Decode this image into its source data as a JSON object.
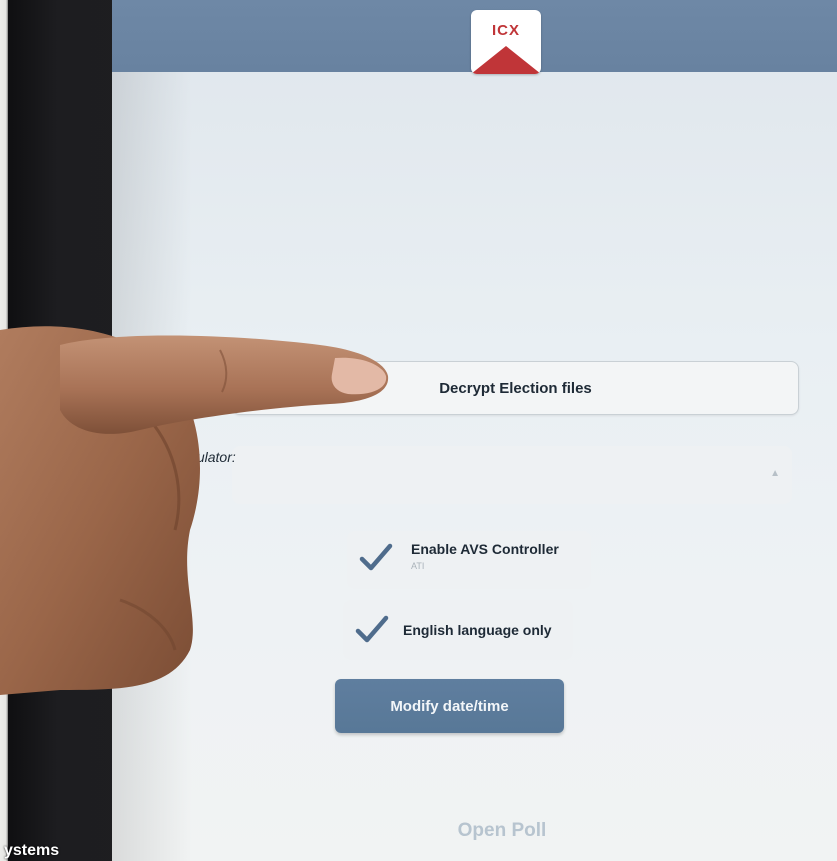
{
  "header": {
    "logo_text": "ICX",
    "colors": {
      "bar": "#6882a0",
      "logo_red": "#c03538"
    }
  },
  "main": {
    "decrypt_label": "Decrypt Election files",
    "tabulator_label": "Tabulator:",
    "tabulator_value": "",
    "avs": {
      "label": "Enable AVS Controller",
      "sublabel": "ATI",
      "checked": true,
      "icon": "checkmark-icon"
    },
    "english": {
      "label": "English language only",
      "checked": true,
      "icon": "checkmark-icon"
    },
    "modify_label": "Modify date/time",
    "open_poll_label": "Open Poll",
    "colors": {
      "primary_button": "#587897",
      "check": "#4f6c8c",
      "disabled_text": "#b7c4cf"
    }
  },
  "overlay": {
    "watermark": "ystems"
  }
}
